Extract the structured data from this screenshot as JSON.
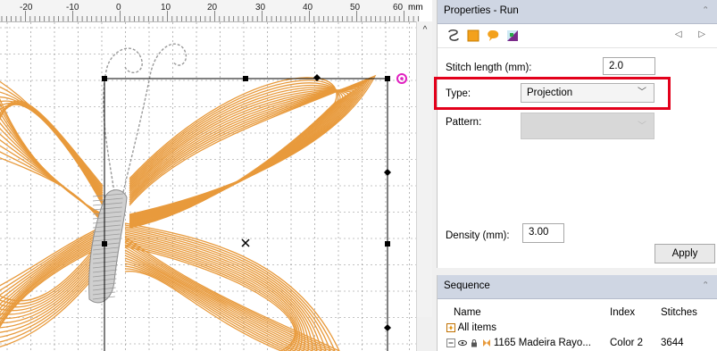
{
  "ruler": {
    "labels": [
      "-20",
      "-10",
      "0",
      "10",
      "20",
      "30",
      "40",
      "50",
      "60"
    ],
    "unit": "mm"
  },
  "properties_panel": {
    "title": "Properties - Run",
    "pin_glyph": "ᵔ",
    "toolbar_icons": [
      "outline-run-icon",
      "fill-square-icon",
      "speech-bubble-icon",
      "embroidery-palette-icon"
    ],
    "nav_arrows": "◁ ▷",
    "stitch_length_label": "Stitch length (mm):",
    "stitch_length_value": "2.0",
    "type_label": "Type:",
    "type_value": "Projection",
    "pattern_label": "Pattern:",
    "pattern_value": "",
    "density_label": "Density (mm):",
    "density_value": "3.00",
    "apply_label": "Apply"
  },
  "sequence_panel": {
    "title": "Sequence",
    "columns": [
      "Name",
      "Index",
      "Stitches"
    ],
    "all_items_label": "All items",
    "rows": [
      {
        "name": "1165 Madeira Rayo...",
        "index": "Color 2",
        "stitches": "3644"
      }
    ]
  },
  "colors": {
    "accent_highlight": "#e3001b",
    "panel_title_bg": "#cfd6e3",
    "thread_orange": "#e89a3c",
    "thread_grey": "#b8b8b8",
    "handle": "#000000"
  }
}
